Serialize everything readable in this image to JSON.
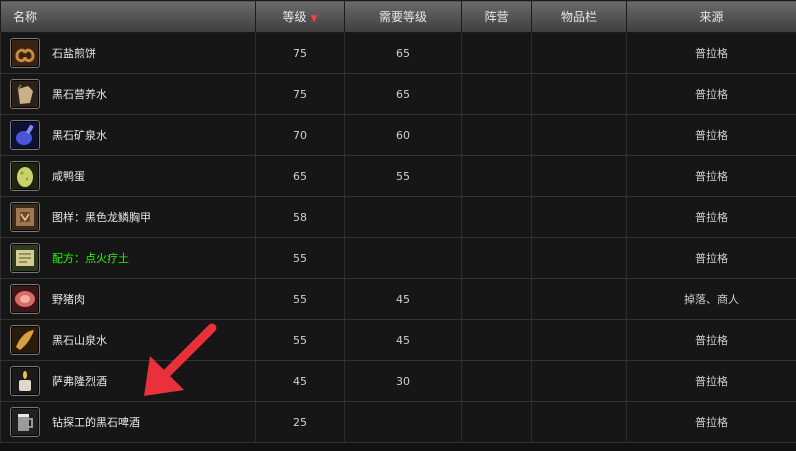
{
  "headers": {
    "name": "名称",
    "level": "等级",
    "sort_indicator": "▼",
    "req_level": "需要等级",
    "faction": "阵营",
    "slot": "物品栏",
    "source": "来源"
  },
  "rows": [
    {
      "icon": "pretzel-icon",
      "name": "石盐煎饼",
      "level": "75",
      "req": "65",
      "faction": "",
      "slot": "",
      "source": "普拉格",
      "recipe": false
    },
    {
      "icon": "waterskin-icon",
      "name": "黑石营养水",
      "level": "75",
      "req": "65",
      "faction": "",
      "slot": "",
      "source": "普拉格",
      "recipe": false
    },
    {
      "icon": "blue-flask-icon",
      "name": "黑石矿泉水",
      "level": "70",
      "req": "60",
      "faction": "",
      "slot": "",
      "source": "普拉格",
      "recipe": false
    },
    {
      "icon": "green-egg-icon",
      "name": "咸鸭蛋",
      "level": "65",
      "req": "55",
      "faction": "",
      "slot": "",
      "source": "普拉格",
      "recipe": false
    },
    {
      "icon": "armor-pattern-icon",
      "name": "图样：黑色龙鳞胸甲",
      "level": "58",
      "req": "",
      "faction": "",
      "slot": "",
      "source": "普拉格",
      "recipe": false
    },
    {
      "icon": "recipe-scroll-icon",
      "name": "配方：点火疗土",
      "level": "55",
      "req": "",
      "faction": "",
      "slot": "",
      "source": "普拉格",
      "recipe": true
    },
    {
      "icon": "meat-icon",
      "name": "野猪肉",
      "level": "55",
      "req": "45",
      "faction": "",
      "slot": "",
      "source": "掉落、商人",
      "recipe": false
    },
    {
      "icon": "horn-flask-icon",
      "name": "黑石山泉水",
      "level": "55",
      "req": "45",
      "faction": "",
      "slot": "",
      "source": "普拉格",
      "recipe": false
    },
    {
      "icon": "candle-icon",
      "name": "萨弗隆烈酒",
      "level": "45",
      "req": "30",
      "faction": "",
      "slot": "",
      "source": "普拉格",
      "recipe": false
    },
    {
      "icon": "beer-mug-icon",
      "name": "钻探工的黑石啤酒",
      "level": "25",
      "req": "",
      "faction": "",
      "slot": "",
      "source": "普拉格",
      "recipe": false
    }
  ],
  "colors": {
    "recipe_text": "#1eff00",
    "arrow": "#e8313a",
    "sort_arrow": "#ff3b3b"
  }
}
